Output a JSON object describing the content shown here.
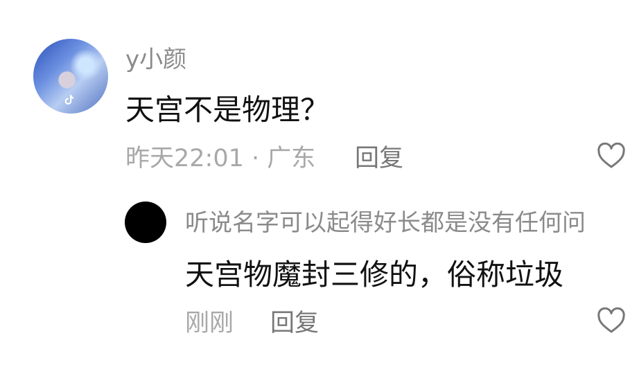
{
  "comment": {
    "username": "y小颜",
    "text": "天宫不是物理？",
    "meta": "昨天22:01 · 广东",
    "reply_label": "回复",
    "avatar_badge_icon": "tiktok-icon",
    "like_icon": "heart-outline-icon"
  },
  "reply": {
    "username": "听说名字可以起得好长都是没有任何问",
    "text": "天宫物魔封三修的，俗称垃圾",
    "time": "刚刚",
    "reply_label": "回复",
    "like_icon": "heart-outline-icon"
  },
  "colors": {
    "primary_text": "#111111",
    "secondary_text": "#8a8a8a",
    "meta_text": "#a8a8a8",
    "background": "#ffffff"
  }
}
